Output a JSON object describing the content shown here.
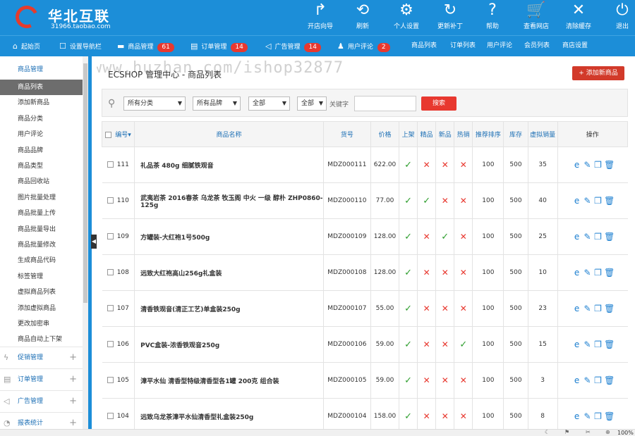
{
  "brand": {
    "name": "华北互联",
    "url": "31966.taobao.com"
  },
  "toolbar": [
    {
      "icon": "share-arrow-icon",
      "glyph": "↱",
      "label": "开店向导"
    },
    {
      "icon": "refresh-icon",
      "glyph": "⟲",
      "label": "刷新"
    },
    {
      "icon": "gear-icon",
      "glyph": "⚙",
      "label": "个人设置"
    },
    {
      "icon": "update-icon",
      "glyph": "↻",
      "label": "更新补丁"
    },
    {
      "icon": "help-icon",
      "glyph": "?",
      "label": "帮助"
    },
    {
      "icon": "cart-icon",
      "glyph": "🛒",
      "label": "查看网店"
    },
    {
      "icon": "close-circle-icon",
      "glyph": "✕",
      "label": "清除缓存"
    },
    {
      "icon": "power-icon",
      "glyph": "⏻",
      "label": "退出"
    }
  ],
  "nav": [
    {
      "icon": "home-icon",
      "glyph": "⌂",
      "label": "起始页"
    },
    {
      "icon": "settings-nav-icon",
      "glyph": "☐",
      "label": "设置导航栏"
    },
    {
      "icon": "folder-icon",
      "glyph": "▬",
      "label": "商品管理",
      "badge": "61"
    },
    {
      "icon": "order-icon",
      "glyph": "▤",
      "label": "订单管理",
      "badge": "14"
    },
    {
      "icon": "megaphone-icon",
      "glyph": "◁",
      "label": "广告管理",
      "badge": "14"
    },
    {
      "icon": "users-icon",
      "glyph": "♟",
      "label": "用户评论",
      "badge": "2"
    },
    {
      "label": "商品列表"
    },
    {
      "label": "订单列表"
    },
    {
      "label": "用户评论"
    },
    {
      "label": "会员列表"
    },
    {
      "label": "商店设置"
    }
  ],
  "sidebar": {
    "header": "商品管理",
    "items": [
      "商品列表",
      "添加新商品",
      "商品分类",
      "用户评论",
      "商品品牌",
      "商品类型",
      "商品回收站",
      "图片批量处理",
      "商品批量上传",
      "商品批量导出",
      "商品批量修改",
      "生成商品代码",
      "标签管理",
      "虚拟商品列表",
      "添加虚拟商品",
      "更改加密串",
      "商品自动上下架"
    ],
    "groups": [
      {
        "icon": "bolt-icon",
        "glyph": "ϟ",
        "label": "促销管理"
      },
      {
        "icon": "order-group-icon",
        "glyph": "▤",
        "label": "订单管理"
      },
      {
        "icon": "ad-group-icon",
        "glyph": "◁",
        "label": "广告管理"
      },
      {
        "icon": "chart-group-icon",
        "glyph": "◔",
        "label": "报表统计"
      }
    ]
  },
  "main": {
    "breadcrumb": "ECSHOP 管理中心 - 商品列表",
    "add_button": "+ 添加新商品",
    "watermark": "https://www.huzhan.com/ishop32877"
  },
  "filters": {
    "category": "所有分类",
    "brand": "所有品牌",
    "type": "全部",
    "status": "全部",
    "keyword_label": "关键字",
    "keyword_value": "",
    "search_button": "搜索"
  },
  "table": {
    "headers": [
      "编号",
      "商品名称",
      "货号",
      "价格",
      "上架",
      "精品",
      "新品",
      "热销",
      "推荐排序",
      "库存",
      "虚拟销量",
      "操作"
    ],
    "rows": [
      {
        "id": "111",
        "name": "礼品茶 480g 细腻铁观音",
        "sn": "MDZ000111",
        "price": "622.00",
        "on_sale": true,
        "best": false,
        "new": false,
        "hot": false,
        "sort": "100",
        "stock": "500",
        "virtual_sales": "35"
      },
      {
        "id": "110",
        "name": "武夷岩茶 2016春茶 乌龙茶 牧玉阁 中火 一级 醇朴 ZHP0860-125g",
        "sn": "MDZ000110",
        "price": "77.00",
        "on_sale": true,
        "best": true,
        "new": false,
        "hot": false,
        "sort": "100",
        "stock": "500",
        "virtual_sales": "40"
      },
      {
        "id": "109",
        "name": "方罐装-大红袍1号500g",
        "sn": "MDZ000109",
        "price": "128.00",
        "on_sale": true,
        "best": false,
        "new": true,
        "hot": false,
        "sort": "100",
        "stock": "500",
        "virtual_sales": "25"
      },
      {
        "id": "108",
        "name": "远致大红袍高山256g礼盒装",
        "sn": "MDZ000108",
        "price": "128.00",
        "on_sale": true,
        "best": false,
        "new": false,
        "hot": false,
        "sort": "100",
        "stock": "500",
        "virtual_sales": "10"
      },
      {
        "id": "107",
        "name": "清香铁观音(清正工艺)单盒装250g",
        "sn": "MDZ000107",
        "price": "55.00",
        "on_sale": true,
        "best": false,
        "new": false,
        "hot": false,
        "sort": "100",
        "stock": "500",
        "virtual_sales": "23"
      },
      {
        "id": "106",
        "name": "PVC盒装-浓香铁观音250g",
        "sn": "MDZ000106",
        "price": "59.00",
        "on_sale": true,
        "best": false,
        "new": false,
        "hot": true,
        "sort": "100",
        "stock": "500",
        "virtual_sales": "15"
      },
      {
        "id": "105",
        "name": "漳平水仙 清香型特级清香型各1罐 200克 组合装",
        "sn": "MDZ000105",
        "price": "59.00",
        "on_sale": true,
        "best": false,
        "new": false,
        "hot": false,
        "sort": "100",
        "stock": "500",
        "virtual_sales": "3"
      },
      {
        "id": "104",
        "name": "远致乌龙茶漳平水仙清香型礼盒装250g",
        "sn": "MDZ000104",
        "price": "158.00",
        "on_sale": true,
        "best": false,
        "new": false,
        "hot": false,
        "sort": "100",
        "stock": "500",
        "virtual_sales": "8"
      }
    ]
  },
  "status_bar": {
    "zoom": "100%"
  },
  "colors": {
    "header_blue": "#1c8ed8",
    "accent_red": "#e8382f",
    "check_green": "#2e9e2e"
  }
}
